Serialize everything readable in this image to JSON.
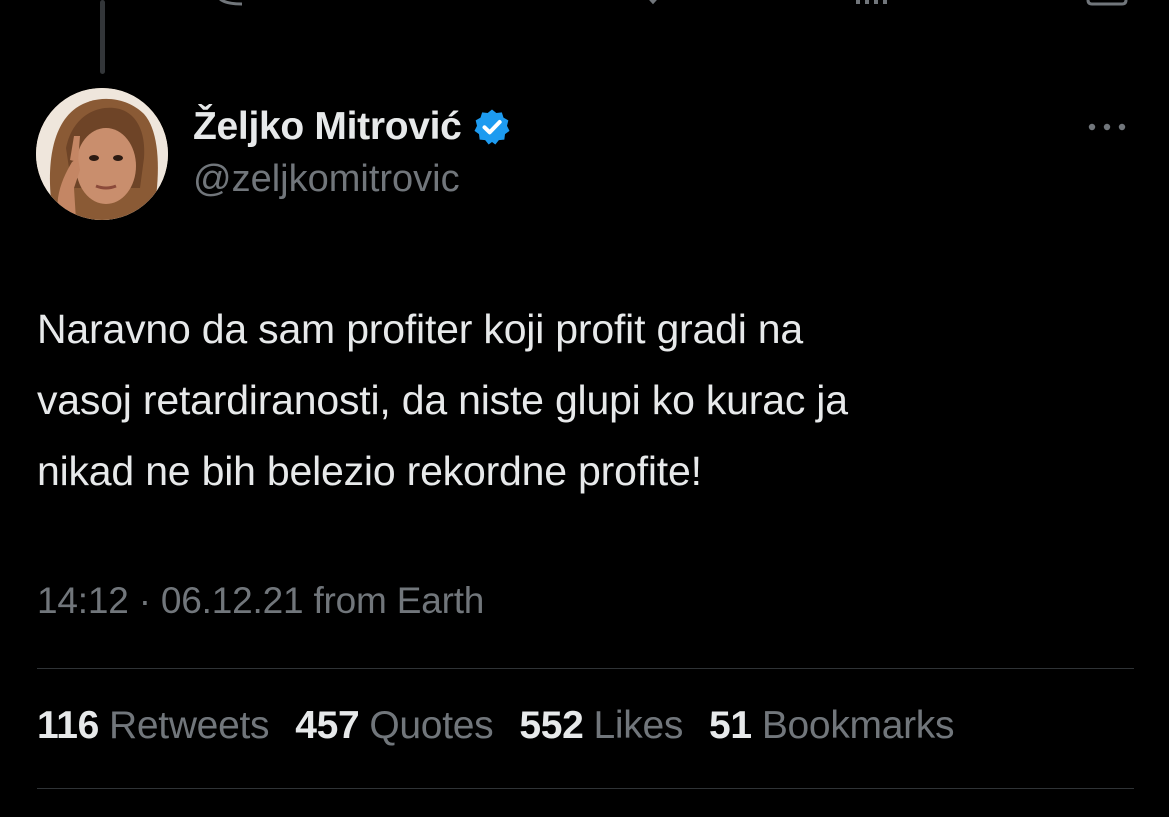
{
  "tweet": {
    "author": {
      "display_name": "Željko Mitrović",
      "handle": "@zeljkomitrovic",
      "verified": true
    },
    "text_lines": [
      "Naravno da sam profiter koji profit gradi na",
      "vasoj retardiranosti, da niste glupi ko kurac ja",
      "nikad ne bih belezio rekordne profite!"
    ],
    "meta": {
      "time": "14:12",
      "separator": "·",
      "date": "06.12.21",
      "source": "from Earth"
    },
    "stats": [
      {
        "count": "116",
        "label": "Retweets"
      },
      {
        "count": "457",
        "label": "Quotes"
      },
      {
        "count": "552",
        "label": "Likes"
      },
      {
        "count": "51",
        "label": "Bookmarks"
      }
    ]
  },
  "icons": {
    "reply": "reply-icon",
    "retweet": "retweet-icon",
    "like": "like-icon",
    "views": "views-icon",
    "share": "share-icon",
    "more": "more-icon",
    "verified": "verified-badge-icon"
  },
  "colors": {
    "background": "#000000",
    "text_primary": "#e7e9ea",
    "text_secondary": "#71767b",
    "verified": "#1d9bf0",
    "divider": "#2f3336"
  }
}
